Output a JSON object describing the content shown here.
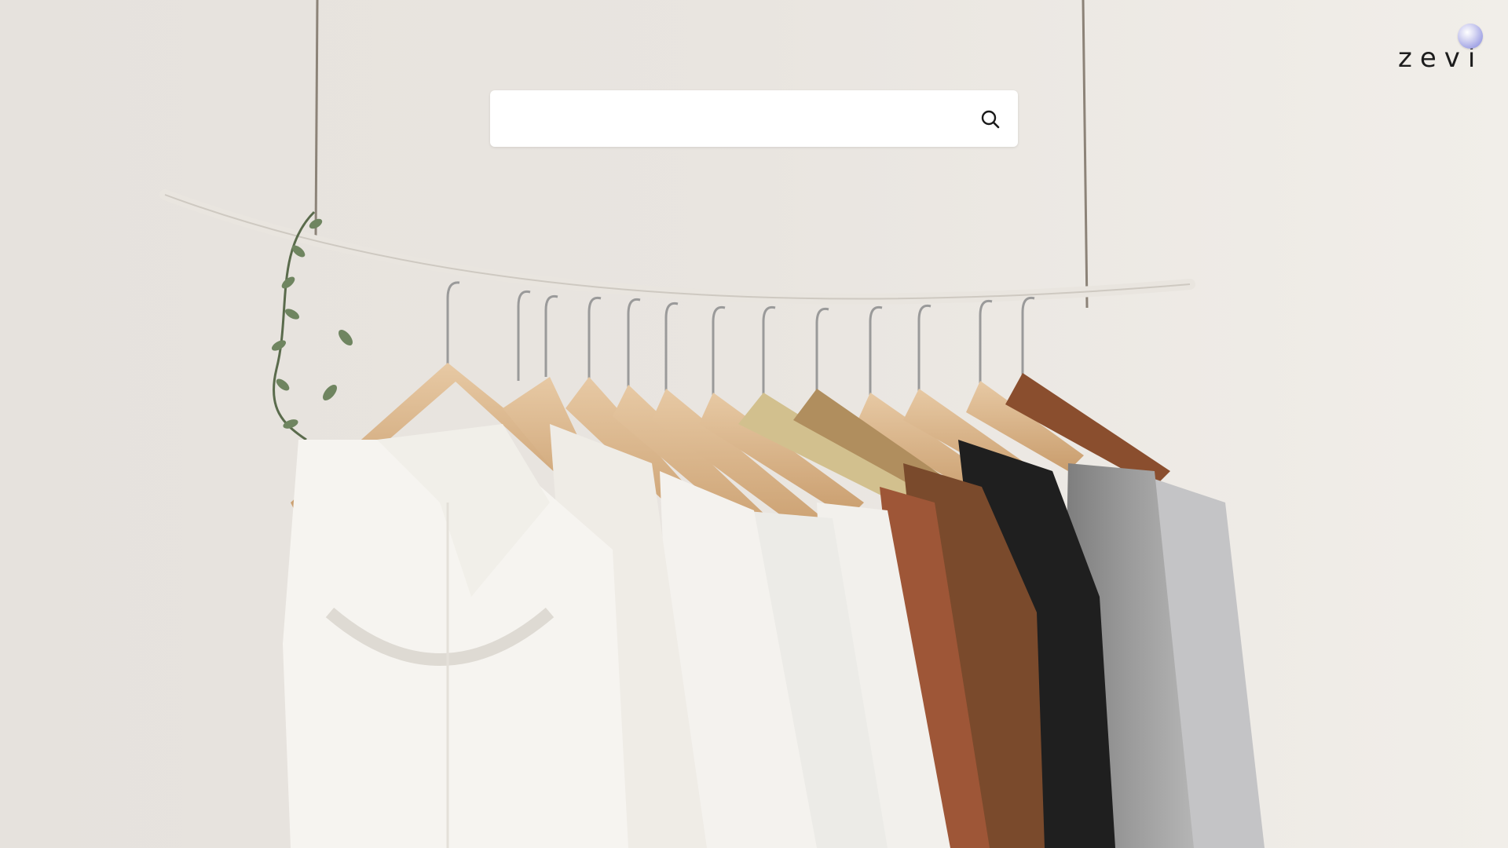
{
  "search": {
    "value": "",
    "placeholder": ""
  },
  "brand": {
    "name": "zevi",
    "orb_color": "#a6a8e6"
  },
  "icons": {
    "search": "search-icon"
  },
  "colors": {
    "wall": "#ebe7e2",
    "search_bg": "#ffffff"
  }
}
